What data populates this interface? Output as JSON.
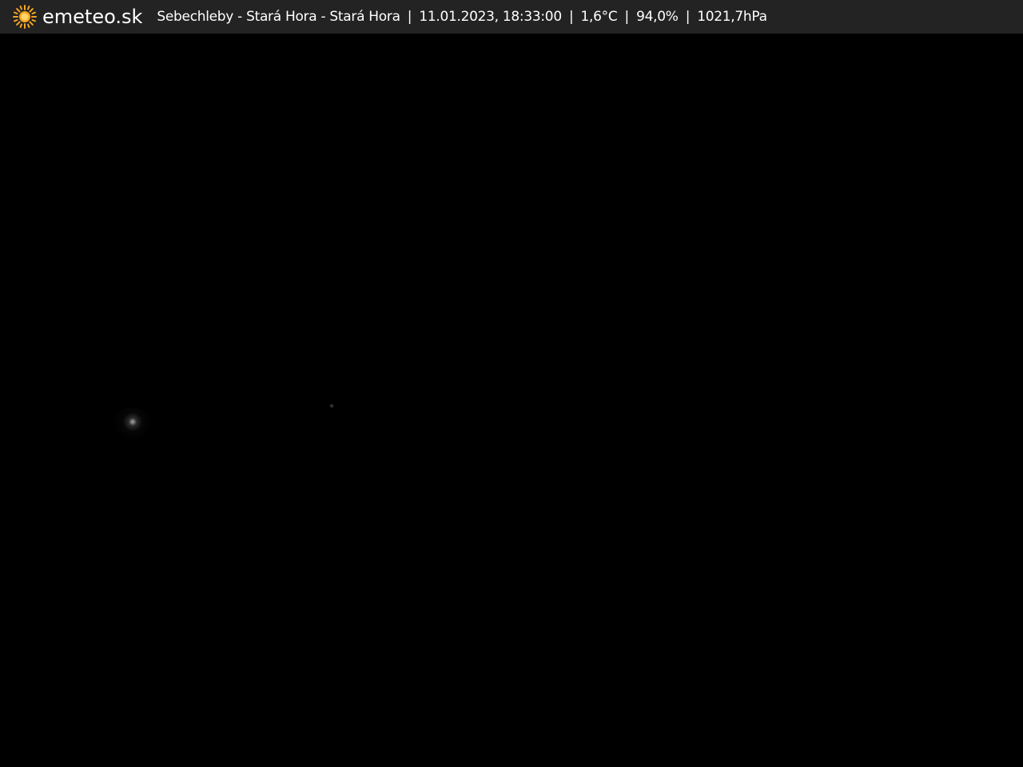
{
  "header": {
    "brand": "emeteo.sk",
    "logo_icon": "sun-icon",
    "location": "Sebechleby - Stará Hora - Stará Hora",
    "datetime": "11.01.2023, 18:33:00",
    "temperature": "1,6°C",
    "humidity": "94,0%",
    "pressure": "1021,7hPa",
    "separator": "|"
  },
  "colors": {
    "header_bg": "#232323",
    "text": "#ffffff",
    "sun": "#f5a623",
    "scene_bg": "#000000"
  }
}
